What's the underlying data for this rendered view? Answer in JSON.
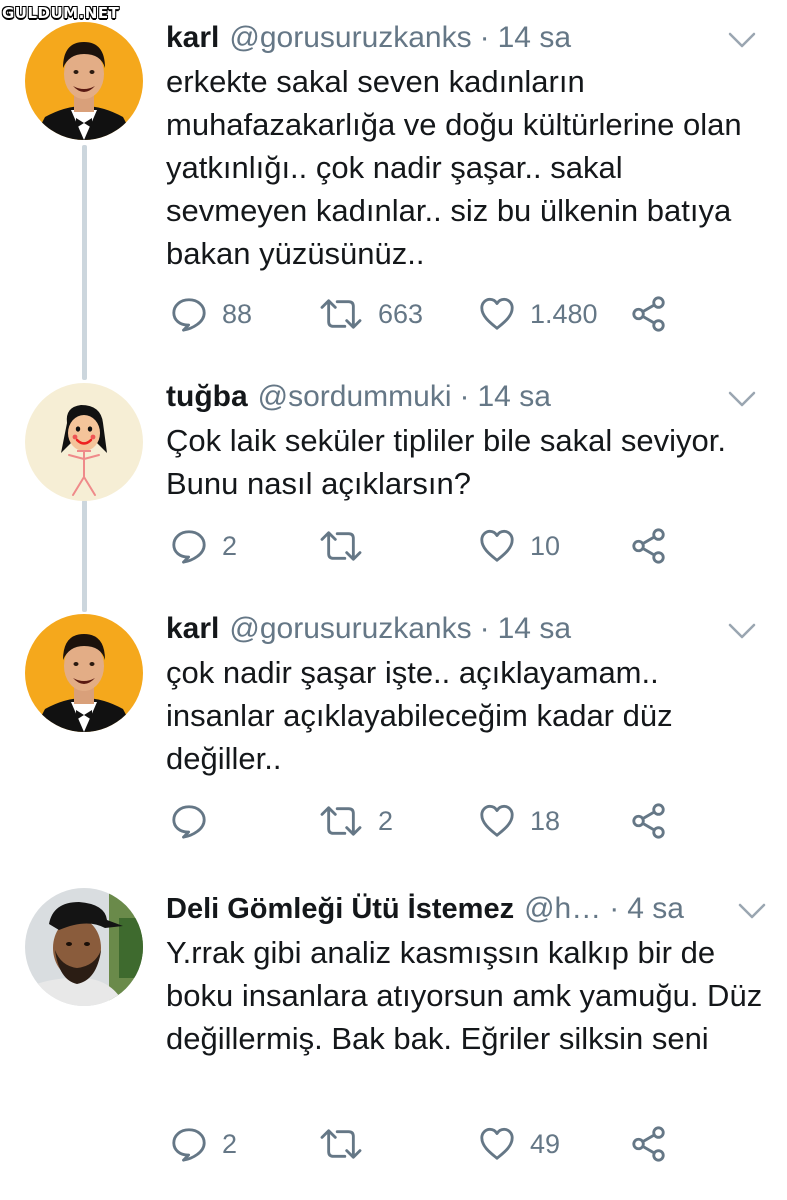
{
  "watermark": "GULDUM.NET",
  "tweets": [
    {
      "name": "karl",
      "handle": "@gorusuruzkanks",
      "separator": "·",
      "time": "14 sa",
      "text": "erkekte sakal seven kadınların muhafazakarlığa ve doğu kültürlerine olan yatkınlığı.. çok nadir şaşar.. sakal sevmeyen kadınlar.. siz bu ülkenin batıya bakan yüzüsünüz..",
      "replies": "88",
      "retweets": "663",
      "likes": "1.480"
    },
    {
      "name": "tuğba",
      "handle": "@sordummuki",
      "separator": "·",
      "time": "14 sa",
      "text": "Çok laik seküler tipliler bile sakal seviyor. Bunu nasıl açıklarsın?",
      "replies": "2",
      "retweets": "",
      "likes": "10"
    },
    {
      "name": "karl",
      "handle": "@gorusuruzkanks",
      "separator": "·",
      "time": "14 sa",
      "text": "çok nadir şaşar işte.. açıklayamam.. insanlar açıklayabileceğim kadar düz değiller..",
      "replies": "",
      "retweets": "2",
      "likes": "18"
    },
    {
      "name": "Deli Gömleği Ütü İstemez",
      "handle": "@h…",
      "separator": "·",
      "time": "4 sa",
      "text": "Y.rrak gibi analiz kasmışsın kalkıp bir de boku insanlara atıyorsun amk yamuğu. Düz değillermiş. Bak bak. Eğriler silksin seni",
      "replies": "2",
      "retweets": "",
      "likes": "49"
    }
  ],
  "colors": {
    "text": "#14171a",
    "muted": "#657786",
    "thread_line": "#ccd6dd",
    "avatar_orange": "#f5a81c",
    "avatar_cream": "#f6eed5"
  },
  "icons": {
    "reply": "reply-icon",
    "retweet": "retweet-icon",
    "like": "like-icon",
    "share": "share-icon",
    "menu": "chevron-down-icon"
  }
}
